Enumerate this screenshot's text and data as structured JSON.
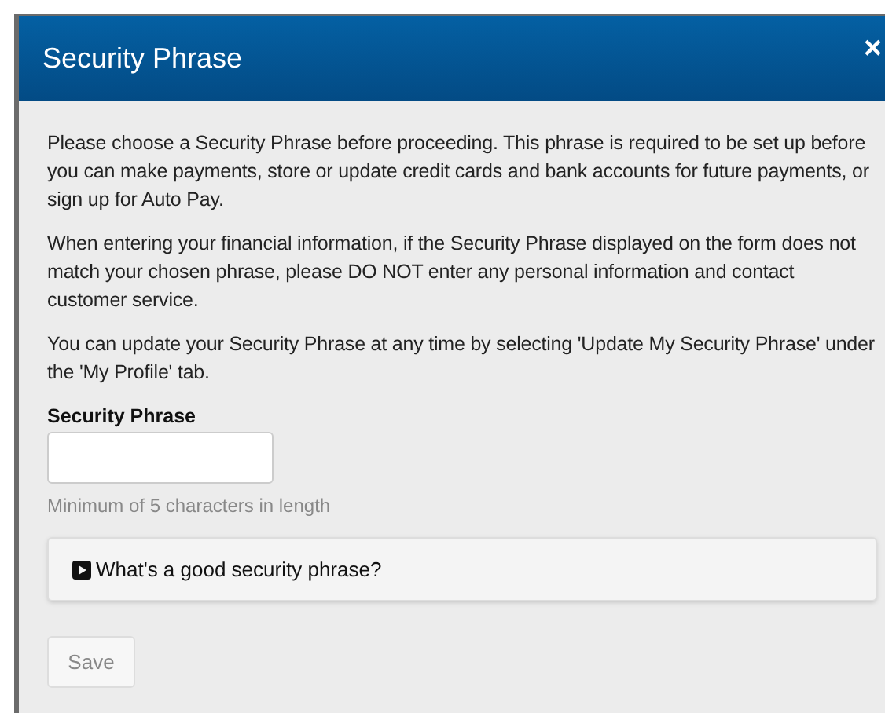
{
  "dialog": {
    "title": "Security Phrase",
    "close": "×",
    "paragraphs": [
      "Please choose a Security Phrase before proceeding. This phrase is required to be set up before you can make payments, store or update credit cards and bank accounts for future payments, or sign up for Auto Pay.",
      "When entering your financial information, if the Security Phrase displayed on the form does not match your chosen phrase, please DO NOT enter any personal information and contact customer service.",
      "You can update your Security Phrase at any time by selecting 'Update My Security Phrase' under the 'My Profile' tab."
    ],
    "field": {
      "label": "Security Phrase",
      "help": "Minimum of 5 characters in length"
    },
    "expander": {
      "label": "What's a good security phrase?",
      "expanded": false
    },
    "save": {
      "label": "Save",
      "disabled": true
    }
  }
}
